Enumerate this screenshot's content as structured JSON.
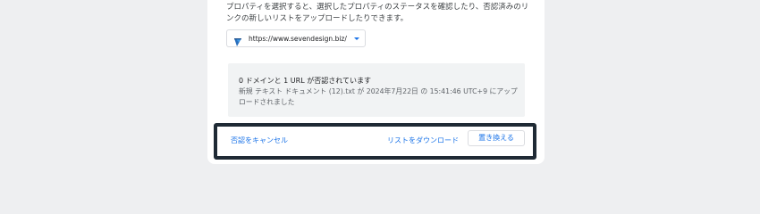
{
  "description": "プロパティを選択すると、選択したプロパティのステータスを確認したり、否認済みのリンクの新しいリストをアップロードしたりできます。",
  "property_select": {
    "selected_value": "https://www.sevendesign.biz/",
    "icon": "site-favicon",
    "caret_icon": "caret-down-icon"
  },
  "status": {
    "title": "0 ドメインと 1 URL が否認されています",
    "detail": "新規 テキスト ドキュメント (12).txt が 2024年7月22日 の 15:41:46 UTC+9 にアップロードされました"
  },
  "actions": {
    "cancel_label": "否認をキャンセル",
    "download_label": "リストをダウンロード",
    "replace_label": "置き換える"
  },
  "colors": {
    "link": "#1a73e8",
    "page_background": "#eeeff1",
    "panel_background": "#f1f3f4",
    "highlight_border": "#1f2a35"
  }
}
